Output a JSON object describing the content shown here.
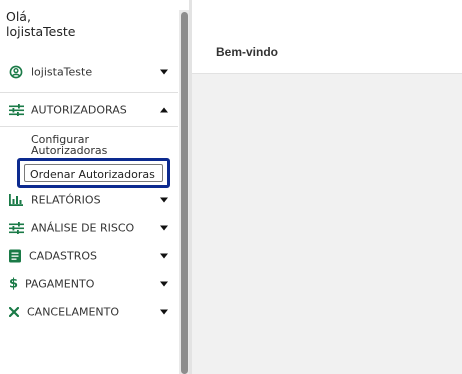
{
  "sidebar": {
    "greeting_line1": "Olá,",
    "greeting_line2": "lojistaTeste",
    "user_menu": {
      "label": "lojistaTeste",
      "icon": "user-circle-icon"
    },
    "sections": {
      "autorizadoras": {
        "label": "AUTORIZADORAS",
        "icon": "sliders-icon",
        "expanded": true
      },
      "relatorios": {
        "label": "RELATÓRIOS",
        "icon": "bar-chart-icon"
      },
      "analise_risco": {
        "label": "ANÁLISE DE RISCO",
        "icon": "sliders-icon"
      },
      "cadastros": {
        "label": "CADASTROS",
        "icon": "document-icon"
      },
      "pagamento": {
        "label": "PAGAMENTO",
        "icon": "dollar-icon"
      },
      "cancelamento": {
        "label": "CANCELAMENTO",
        "icon": "close-icon"
      }
    },
    "autorizadoras_items": {
      "configurar_line1": "Configurar",
      "configurar_line2": "Autorizadoras",
      "ordenar": "Ordenar Autorizadoras"
    }
  },
  "main": {
    "header_title": "Bem-vindo"
  },
  "colors": {
    "icon_green": "#1a7a47",
    "highlight_border": "#0c2a8f",
    "content_bg": "#f1f1f1"
  }
}
